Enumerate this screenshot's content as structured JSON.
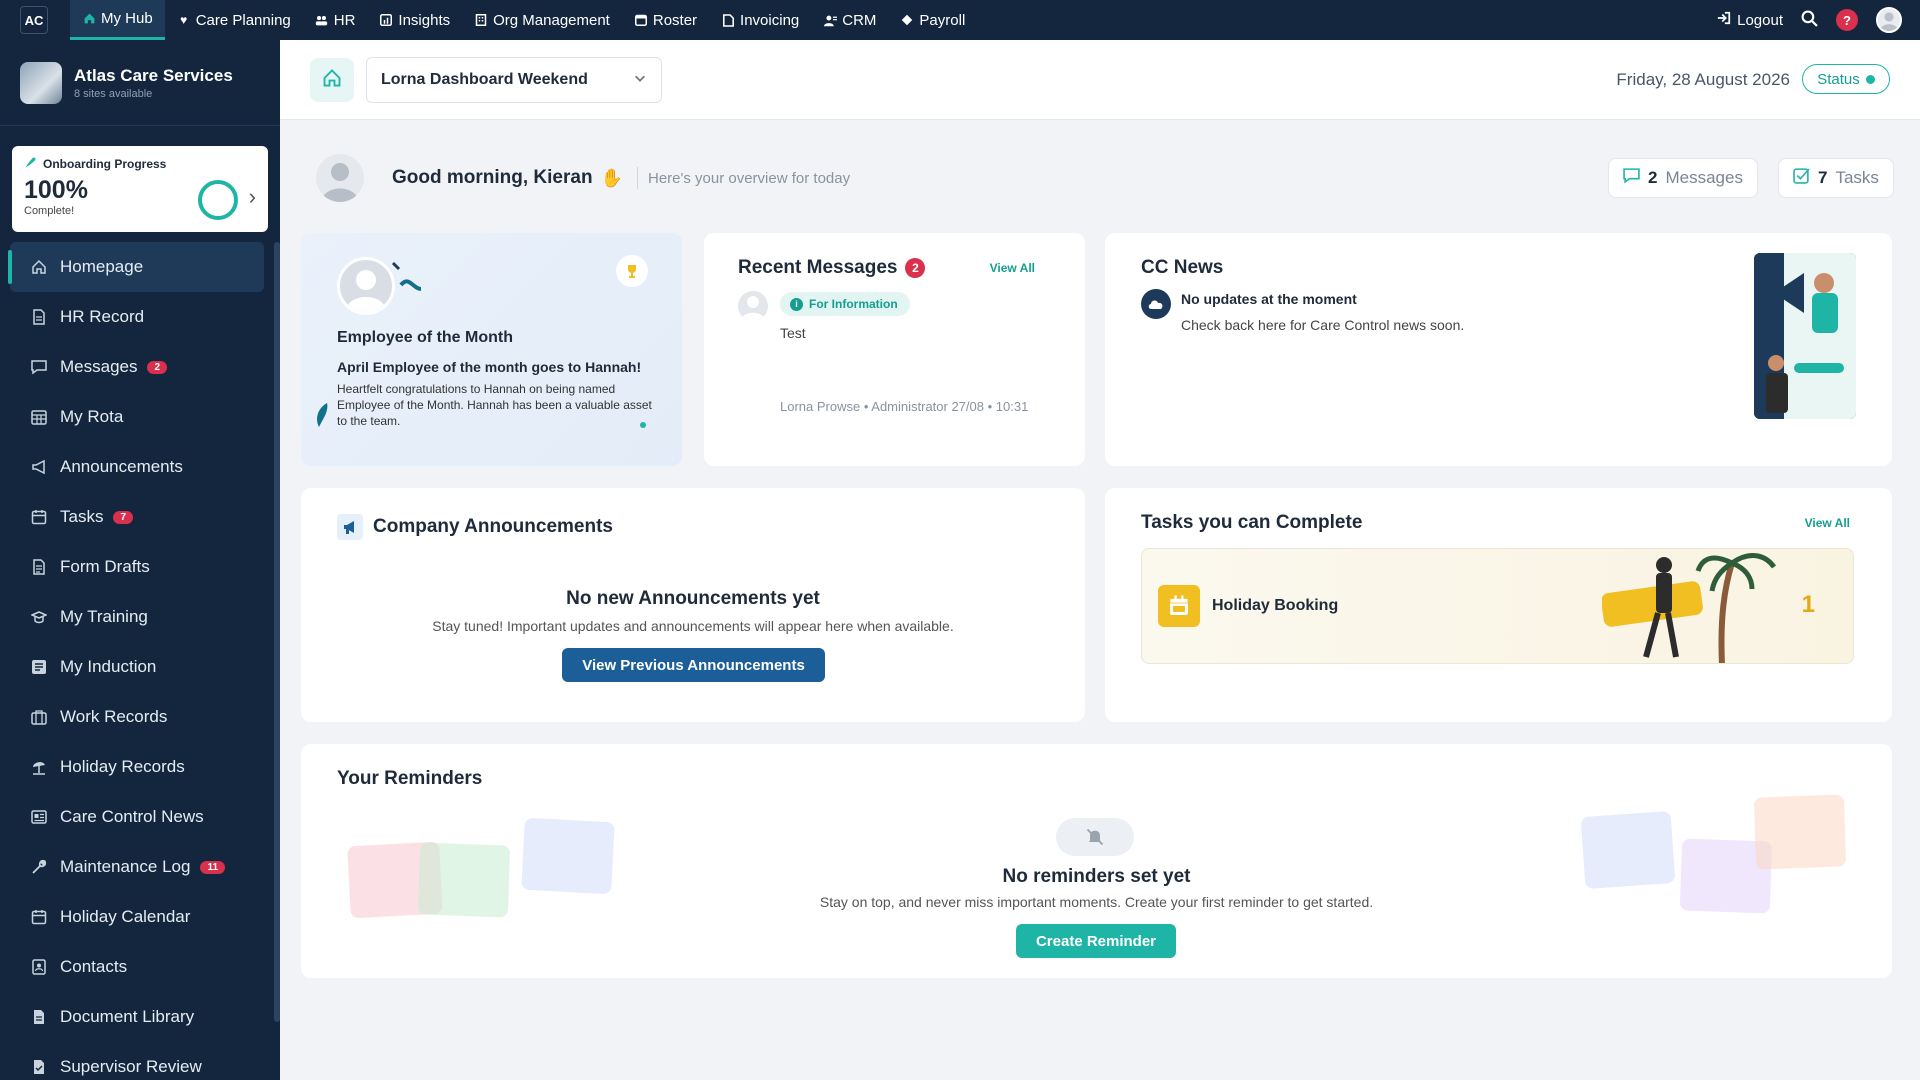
{
  "topnav": {
    "logo": "AC",
    "items": [
      {
        "label": "My Hub",
        "icon": "home-icon"
      },
      {
        "label": "Care Planning",
        "icon": "heart-icon"
      },
      {
        "label": "HR",
        "icon": "people-icon"
      },
      {
        "label": "Insights",
        "icon": "chart-icon"
      },
      {
        "label": "Org Management",
        "icon": "building-icon"
      },
      {
        "label": "Roster",
        "icon": "calendar-icon"
      },
      {
        "label": "Invoicing",
        "icon": "document-icon"
      },
      {
        "label": "CRM",
        "icon": "contacts-icon"
      },
      {
        "label": "Payroll",
        "icon": "payroll-icon"
      }
    ],
    "logout": "Logout",
    "help": "?"
  },
  "sidebar": {
    "org_name": "Atlas Care Services",
    "org_sub": "8 sites available",
    "onboarding": {
      "title": "Onboarding Progress",
      "percent": "100%",
      "sub": "Complete!",
      "progress": 1.0
    },
    "items": [
      {
        "label": "Homepage",
        "icon": "home-icon",
        "badge": ""
      },
      {
        "label": "HR Record",
        "icon": "file-icon",
        "badge": ""
      },
      {
        "label": "Messages",
        "icon": "message-icon",
        "badge": "2"
      },
      {
        "label": "My Rota",
        "icon": "grid-calendar-icon",
        "badge": ""
      },
      {
        "label": "Announcements",
        "icon": "megaphone-icon",
        "badge": ""
      },
      {
        "label": "Tasks",
        "icon": "calendar-icon",
        "badge": "7"
      },
      {
        "label": "Form Drafts",
        "icon": "form-icon",
        "badge": ""
      },
      {
        "label": "My Training",
        "icon": "graduation-icon",
        "badge": ""
      },
      {
        "label": "My Induction",
        "icon": "induction-icon",
        "badge": ""
      },
      {
        "label": "Work Records",
        "icon": "briefcase-icon",
        "badge": ""
      },
      {
        "label": "Holiday Records",
        "icon": "beach-icon",
        "badge": ""
      },
      {
        "label": "Care Control News",
        "icon": "news-icon",
        "badge": ""
      },
      {
        "label": "Maintenance Log",
        "icon": "wrench-icon",
        "badge": "11"
      },
      {
        "label": "Holiday Calendar",
        "icon": "calendar-icon",
        "badge": ""
      },
      {
        "label": "Contacts",
        "icon": "contact-card-icon",
        "badge": ""
      },
      {
        "label": "Document Library",
        "icon": "document-icon",
        "badge": ""
      },
      {
        "label": "Supervisor Review",
        "icon": "review-icon",
        "badge": ""
      }
    ]
  },
  "header": {
    "dashboard_select": "Lorna Dashboard Weekend",
    "date": "Friday, 28 August 2026",
    "status": "Status"
  },
  "greeting": {
    "text": "Good morning, Kieran",
    "sub": "Here's your overview for today",
    "messages_count": "2",
    "messages_label": "Messages",
    "tasks_count": "7",
    "tasks_label": "Tasks"
  },
  "employee_of_month": {
    "title": "Employee of the Month",
    "headline": "April Employee of the month goes to Hannah!",
    "body": "Heartfelt congratulations to Hannah on being named Employee of the Month. Hannah has been a valuable asset to the team."
  },
  "recent_messages": {
    "title": "Recent Messages",
    "badge": "2",
    "view_all": "View All",
    "tag": "For Information",
    "body": "Test",
    "meta": "Lorna Prowse • Administrator  27/08 • 10:31"
  },
  "news": {
    "title": "CC News",
    "headline": "No updates at the moment",
    "sub": "Check back here for Care Control news soon."
  },
  "announcements": {
    "title": "Company Announcements",
    "empty": "No new Announcements yet",
    "sub": "Stay tuned! Important updates and announcements will appear here when available.",
    "button": "View Previous Announcements"
  },
  "tasks": {
    "title": "Tasks you can Complete",
    "view_all": "View All",
    "item_name": "Holiday Booking",
    "item_count": "1"
  },
  "reminders": {
    "title": "Your Reminders",
    "empty": "No reminders set yet",
    "sub": "Stay on top, and never miss important moments. Create your first reminder to get started.",
    "button": "Create Reminder"
  },
  "colors": {
    "nav_bg": "#13263d",
    "accent": "#1fb5a6",
    "primary_button": "#1b5e98",
    "badge": "#d9304d"
  }
}
